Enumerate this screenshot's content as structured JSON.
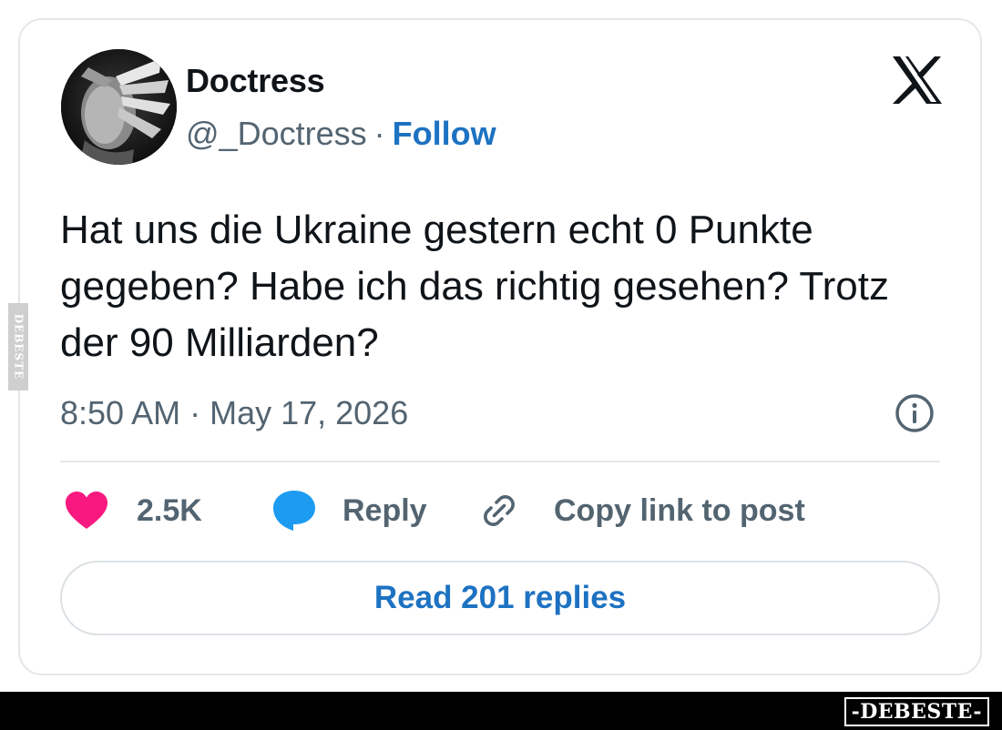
{
  "tweet": {
    "author_name": "Doctress",
    "author_handle": "@_Doctress",
    "handle_separator": "·",
    "follow_label": "Follow",
    "text": "Hat uns die Ukraine gestern echt 0 Punkte gegeben? Habe ich das richtig gesehen? Trotz der 90 Milliarden?",
    "timestamp": "8:50 AM · May 17, 2026",
    "likes_count": "2.5K",
    "reply_label": "Reply",
    "copy_link_label": "Copy link to post",
    "read_replies_label": "Read 201 replies"
  },
  "icons": {
    "logo": "x-logo-icon",
    "info": "info-icon",
    "like": "heart-icon",
    "reply": "speech-bubble-icon",
    "copy": "link-icon"
  },
  "colors": {
    "link_blue": "#1d72c2",
    "heart_pink": "#f91880",
    "reply_blue": "#1d9bf0",
    "secondary_text": "#536471",
    "primary_text": "#0f1419"
  },
  "watermark": {
    "side_text": "DEBESTE",
    "brand_text": "-DEBESTE-"
  }
}
